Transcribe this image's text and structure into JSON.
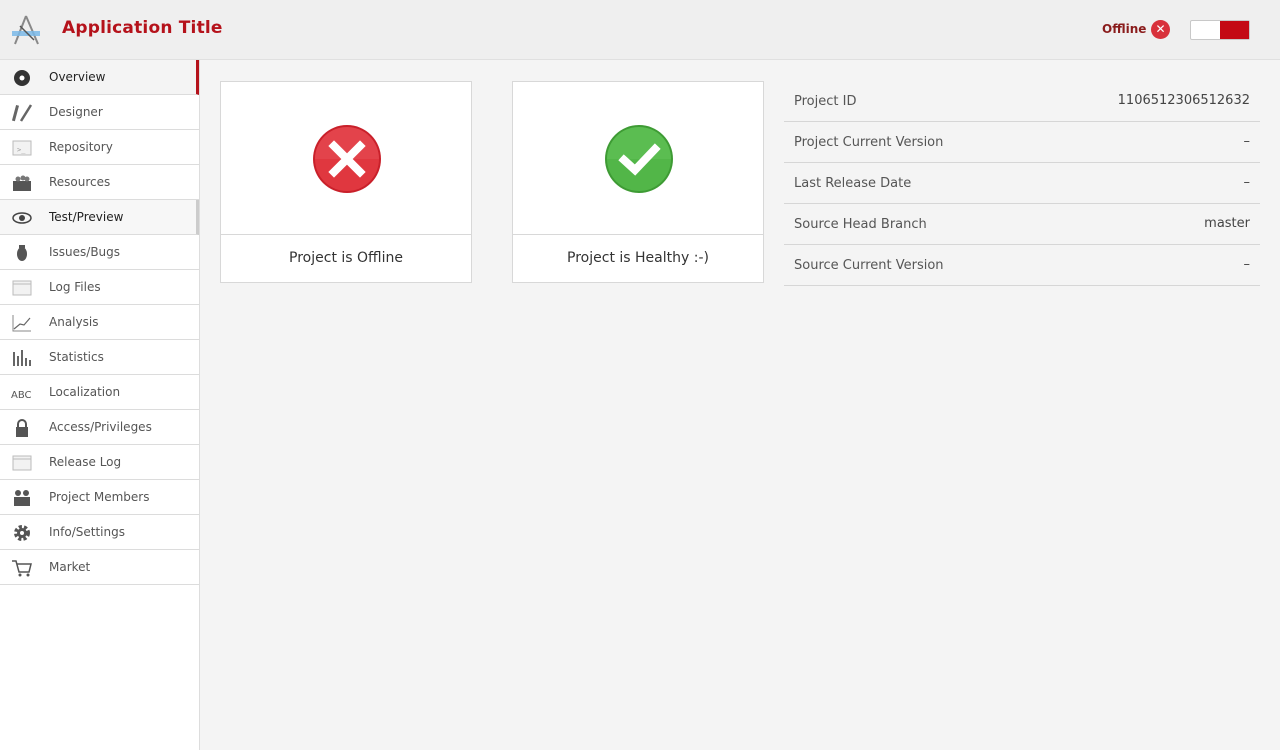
{
  "header": {
    "title": "Application Title",
    "status_label": "Offline",
    "status_icon": "close-circle-icon",
    "accent_color": "#b5121b"
  },
  "sidebar": {
    "items": [
      {
        "label": "Overview",
        "icon": "dot-circle-icon"
      },
      {
        "label": "Designer",
        "icon": "pencil-ruler-icon"
      },
      {
        "label": "Repository",
        "icon": "terminal-window-icon"
      },
      {
        "label": "Resources",
        "icon": "basket-icon"
      },
      {
        "label": "Test/Preview",
        "icon": "eye-icon"
      },
      {
        "label": "Issues/Bugs",
        "icon": "bug-icon"
      },
      {
        "label": "Log Files",
        "icon": "window-icon"
      },
      {
        "label": "Analysis",
        "icon": "line-graph-icon"
      },
      {
        "label": "Statistics",
        "icon": "bar-chart-icon"
      },
      {
        "label": "Localization",
        "icon": "abc-icon"
      },
      {
        "label": "Access/Privileges",
        "icon": "lock-icon"
      },
      {
        "label": "Release Log",
        "icon": "window-icon"
      },
      {
        "label": "Project Members",
        "icon": "people-icon"
      },
      {
        "label": "Info/Settings",
        "icon": "gear-icon"
      },
      {
        "label": "Market",
        "icon": "cart-icon"
      }
    ],
    "active_index": 0
  },
  "cards": [
    {
      "label": "Project is Offline",
      "icon": "error-x-icon",
      "color": "#d8313b"
    },
    {
      "label": "Project is Healthy :-)",
      "icon": "check-icon",
      "color": "#4caf3f"
    }
  ],
  "info": {
    "rows": [
      {
        "key": "Project ID",
        "value": "1106512306512632"
      },
      {
        "key": "Project Current Version",
        "value": "–"
      },
      {
        "key": "Last Release Date",
        "value": "–"
      },
      {
        "key": "Source Head Branch",
        "value": "master"
      },
      {
        "key": "Source Current Version",
        "value": "–"
      }
    ]
  }
}
